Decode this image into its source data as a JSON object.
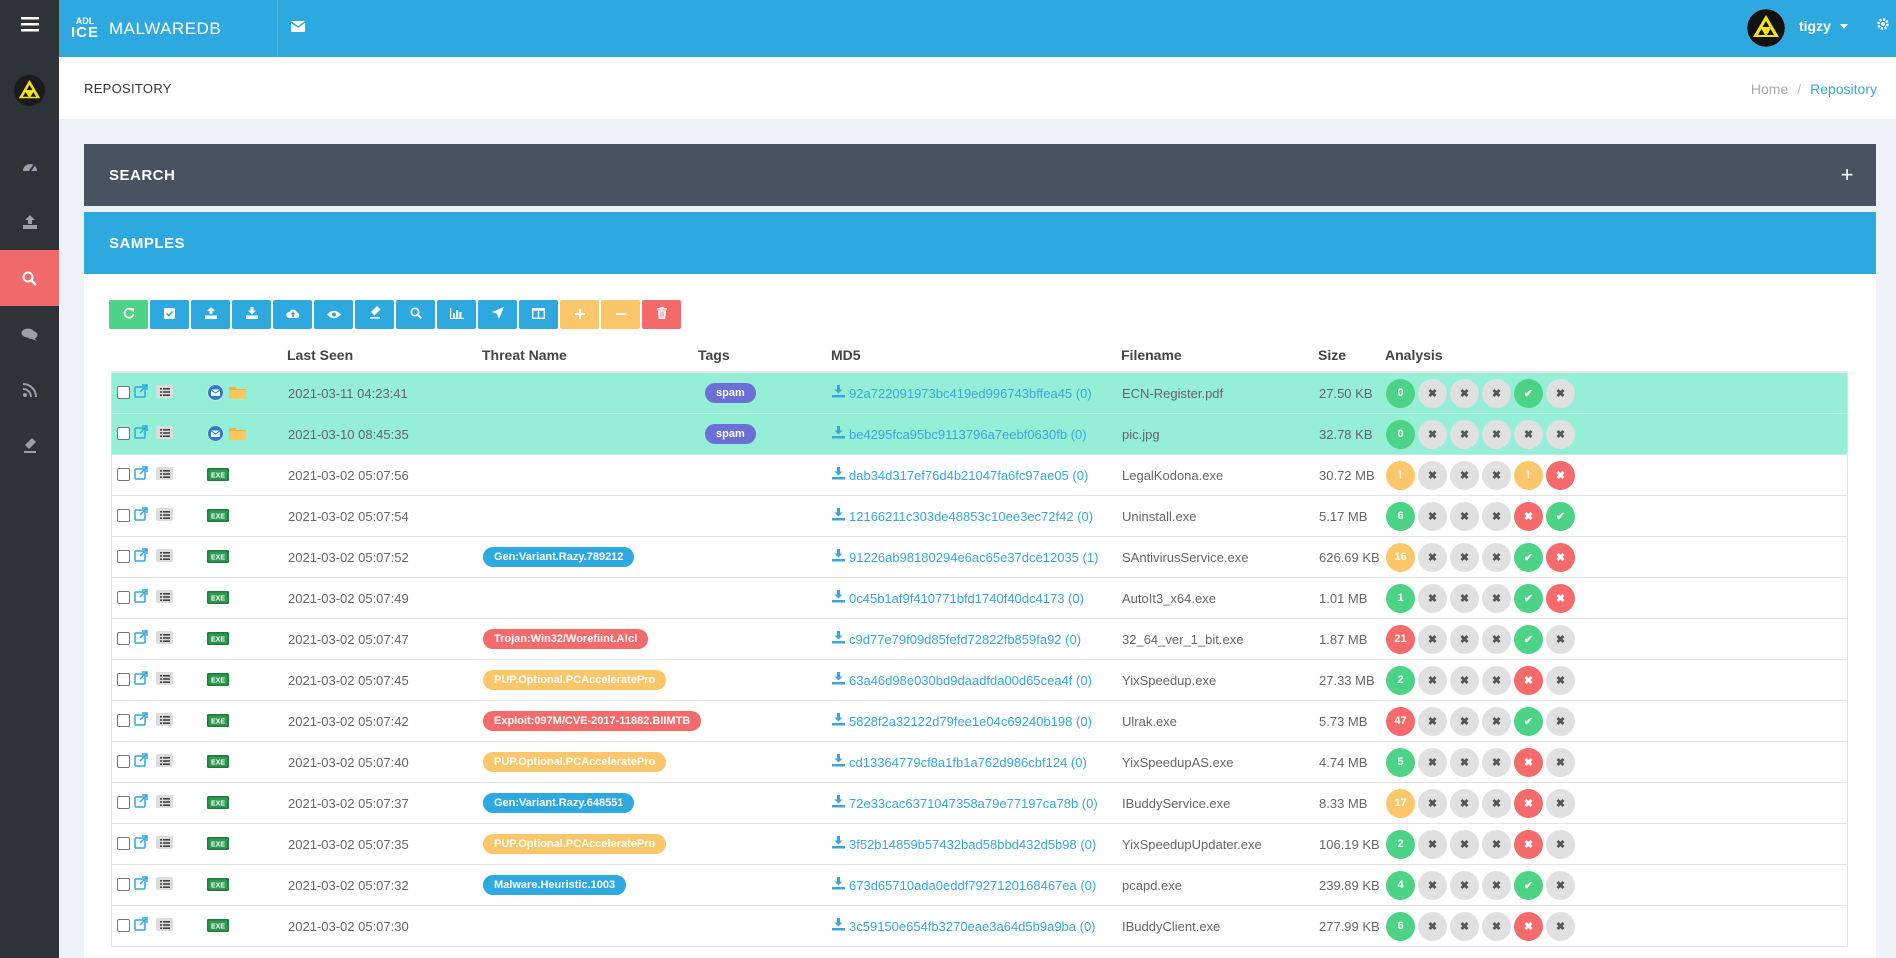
{
  "app": {
    "brand_top": "ADL",
    "brand_bottom": "ICE",
    "brand_name": "MALWAREDB",
    "username": "tigzy"
  },
  "page": {
    "title": "REPOSITORY",
    "breadcrumb_home": "Home",
    "breadcrumb_sep": "/",
    "breadcrumb_current": "Repository"
  },
  "panels": {
    "search_title": "SEARCH",
    "search_expand": "+",
    "samples_title": "SAMPLES"
  },
  "sidebar": {
    "items": [
      {
        "icon": "dashboard-icon"
      },
      {
        "icon": "upload-icon"
      },
      {
        "icon": "search-icon",
        "active": true
      },
      {
        "icon": "comments-icon"
      },
      {
        "icon": "rss-icon"
      },
      {
        "icon": "eraser-icon"
      }
    ]
  },
  "toolbar": {
    "buttons": [
      {
        "icon": "refresh-icon",
        "color": "green"
      },
      {
        "icon": "check-square-icon",
        "color": "blue"
      },
      {
        "icon": "upload-icon",
        "color": "blue"
      },
      {
        "icon": "download-icon",
        "color": "blue"
      },
      {
        "icon": "cloud-upload-icon",
        "color": "blue"
      },
      {
        "icon": "eye-icon",
        "color": "blue"
      },
      {
        "icon": "eraser-icon",
        "color": "blue"
      },
      {
        "icon": "search-icon",
        "color": "blue"
      },
      {
        "icon": "bar-chart-icon",
        "color": "blue"
      },
      {
        "icon": "rocket-icon",
        "color": "blue"
      },
      {
        "icon": "columns-icon",
        "color": "blue"
      },
      {
        "icon": "plus-icon",
        "color": "orange"
      },
      {
        "icon": "minus-icon",
        "color": "orange"
      },
      {
        "icon": "trash-icon",
        "color": "red"
      }
    ]
  },
  "table": {
    "headers": {
      "last_seen": "Last Seen",
      "threat_name": "Threat Name",
      "tags": "Tags",
      "md5": "MD5",
      "filename": "Filename",
      "size": "Size",
      "analysis": "Analysis"
    },
    "rows": [
      {
        "highlight": true,
        "type": "email",
        "date": "2021-03-11 04:23:41",
        "threat": "",
        "threat_color": "",
        "tag": "spam",
        "md5": "92a722091973bc419ed996743bffea45 (0)",
        "filename": "ECN-Register.pdf",
        "size": "27.50 KB",
        "score": "0",
        "score_color": "green",
        "statuses": [
          "x",
          "x",
          "x",
          "check",
          "x"
        ]
      },
      {
        "highlight": true,
        "type": "email",
        "date": "2021-03-10 08:45:35",
        "threat": "",
        "threat_color": "",
        "tag": "spam",
        "md5": "be4295fca95bc9113796a7eebf0630fb (0)",
        "filename": "pic.jpg",
        "size": "32.78 KB",
        "score": "0",
        "score_color": "green",
        "statuses": [
          "x",
          "x",
          "x",
          "x",
          "x"
        ]
      },
      {
        "highlight": false,
        "type": "exe",
        "date": "2021-03-02 05:07:56",
        "threat": "",
        "threat_color": "",
        "tag": "",
        "md5": "dab34d317ef76d4b21047fa6fc97ae05 (0)",
        "filename": "LegalKodona.exe",
        "size": "30.72 MB",
        "score": "!",
        "score_color": "orange",
        "statuses": [
          "x",
          "x",
          "x",
          "warn",
          "fail"
        ]
      },
      {
        "highlight": false,
        "type": "exe",
        "date": "2021-03-02 05:07:54",
        "threat": "",
        "threat_color": "",
        "tag": "",
        "md5": "12166211c303de48853c10ee3ec72f42 (0)",
        "filename": "Uninstall.exe",
        "size": "5.17 MB",
        "score": "6",
        "score_color": "green",
        "statuses": [
          "x",
          "x",
          "x",
          "fail",
          "check"
        ]
      },
      {
        "highlight": false,
        "type": "exe",
        "date": "2021-03-02 05:07:52",
        "threat": "Gen:Variant.Razy.789212",
        "threat_color": "blue",
        "tag": "",
        "md5": "91226ab98180294e6ac65e37dce12035 (1)",
        "filename": "SAntivirusService.exe",
        "size": "626.69 KB",
        "score": "16",
        "score_color": "orange",
        "statuses": [
          "x",
          "x",
          "x",
          "check",
          "fail"
        ]
      },
      {
        "highlight": false,
        "type": "exe",
        "date": "2021-03-02 05:07:49",
        "threat": "",
        "threat_color": "",
        "tag": "",
        "md5": "0c45b1af9f410771bfd1740f40dc4173 (0)",
        "filename": "AutoIt3_x64.exe",
        "size": "1.01 MB",
        "score": "1",
        "score_color": "green",
        "statuses": [
          "x",
          "x",
          "x",
          "check",
          "fail"
        ]
      },
      {
        "highlight": false,
        "type": "exe",
        "date": "2021-03-02 05:07:47",
        "threat": "Trojan:Win32/Worefiint.A!cl",
        "threat_color": "red",
        "tag": "",
        "md5": "c9d77e79f09d85fefd72822fb859fa92 (0)",
        "filename": "32_64_ver_1_bit.exe",
        "size": "1.87 MB",
        "score": "21",
        "score_color": "red",
        "statuses": [
          "x",
          "x",
          "x",
          "check",
          "x"
        ]
      },
      {
        "highlight": false,
        "type": "exe",
        "date": "2021-03-02 05:07:45",
        "threat": "PUP.Optional.PCAcceleratePro",
        "threat_color": "orange",
        "tag": "",
        "md5": "63a46d98e030bd9daadfda00d65cea4f (0)",
        "filename": "YixSpeedup.exe",
        "size": "27.33 MB",
        "score": "2",
        "score_color": "green",
        "statuses": [
          "x",
          "x",
          "x",
          "fail",
          "x"
        ]
      },
      {
        "highlight": false,
        "type": "exe",
        "date": "2021-03-02 05:07:42",
        "threat": "Exploit:097M/CVE-2017-11882.BIIMTB",
        "threat_color": "red",
        "tag": "",
        "md5": "5828f2a32122d79fee1e04c69240b198 (0)",
        "filename": "Ulrak.exe",
        "size": "5.73 MB",
        "score": "47",
        "score_color": "red",
        "statuses": [
          "x",
          "x",
          "x",
          "check",
          "x"
        ]
      },
      {
        "highlight": false,
        "type": "exe",
        "date": "2021-03-02 05:07:40",
        "threat": "PUP.Optional.PCAcceleratePro",
        "threat_color": "orange",
        "tag": "",
        "md5": "cd13364779cf8a1fb1a762d986cbf124 (0)",
        "filename": "YixSpeedupAS.exe",
        "size": "4.74 MB",
        "score": "5",
        "score_color": "green",
        "statuses": [
          "x",
          "x",
          "x",
          "fail",
          "x"
        ]
      },
      {
        "highlight": false,
        "type": "exe",
        "date": "2021-03-02 05:07:37",
        "threat": "Gen:Variant.Razy.648551",
        "threat_color": "blue",
        "tag": "",
        "md5": "72e33cac6371047358a79e77197ca78b (0)",
        "filename": "IBuddyService.exe",
        "size": "8.33 MB",
        "score": "17",
        "score_color": "orange",
        "statuses": [
          "x",
          "x",
          "x",
          "fail",
          "x"
        ]
      },
      {
        "highlight": false,
        "type": "exe",
        "date": "2021-03-02 05:07:35",
        "threat": "PUP.Optional.PCAcceleratePro",
        "threat_color": "orange",
        "tag": "",
        "md5": "3f52b14859b57432bad58bbd432d5b98 (0)",
        "filename": "YixSpeedupUpdater.exe",
        "size": "106.19 KB",
        "score": "2",
        "score_color": "green",
        "statuses": [
          "x",
          "x",
          "x",
          "fail",
          "x"
        ]
      },
      {
        "highlight": false,
        "type": "exe",
        "date": "2021-03-02 05:07:32",
        "threat": "Malware.Heuristic.1003",
        "threat_color": "blue",
        "tag": "",
        "md5": "673d65710ada0eddf7927120168467ea (0)",
        "filename": "pcapd.exe",
        "size": "239.89 KB",
        "score": "4",
        "score_color": "green",
        "statuses": [
          "x",
          "x",
          "x",
          "check",
          "x"
        ]
      },
      {
        "highlight": false,
        "type": "exe",
        "date": "2021-03-02 05:07:30",
        "threat": "",
        "threat_color": "",
        "tag": "",
        "md5": "3c59150e654fb3270eae3a64d5b9a9ba (0)",
        "filename": "IBuddyClient.exe",
        "size": "277.99 KB",
        "score": "6",
        "score_color": "green",
        "statuses": [
          "x",
          "x",
          "x",
          "fail",
          "x"
        ]
      }
    ]
  }
}
